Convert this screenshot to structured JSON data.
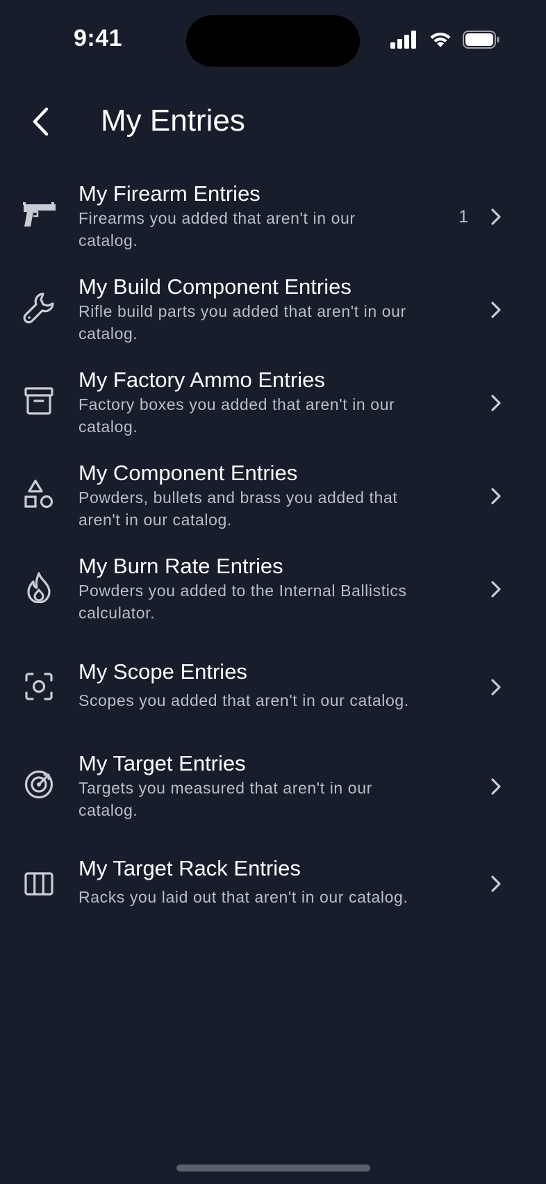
{
  "status_bar": {
    "time": "9:41"
  },
  "header": {
    "title": "My Entries"
  },
  "entries": [
    {
      "title": "My Firearm Entries",
      "subtitle": "Firearms you added that aren't in our catalog.",
      "count": "1",
      "icon": "pistol-icon"
    },
    {
      "title": "My Build Component Entries",
      "subtitle": "Rifle build parts you added that aren't in our catalog.",
      "count": "",
      "icon": "wrench-icon"
    },
    {
      "title": "My Factory Ammo Entries",
      "subtitle": "Factory boxes you added that aren't in our catalog.",
      "count": "",
      "icon": "archive-box-icon"
    },
    {
      "title": "My Component Entries",
      "subtitle": "Powders, bullets and brass you added that aren't in our catalog.",
      "count": "",
      "icon": "shapes-icon"
    },
    {
      "title": "My Burn Rate Entries",
      "subtitle": "Powders you added to the Internal Ballistics calculator.",
      "count": "",
      "icon": "flame-icon"
    },
    {
      "title": "My Scope Entries",
      "subtitle": "Scopes you added that aren't in our catalog.",
      "count": "",
      "icon": "scope-focus-icon"
    },
    {
      "title": "My Target Entries",
      "subtitle": "Targets you measured that aren't in our catalog.",
      "count": "",
      "icon": "target-icon"
    },
    {
      "title": "My Target Rack Entries",
      "subtitle": "Racks you laid out that aren't in our catalog.",
      "count": "",
      "icon": "rack-columns-icon"
    }
  ],
  "colors": {
    "background": "#181d2b",
    "title_text": "#ffffff",
    "subtitle_text": "#b9bdc8",
    "icon": "#c9ccd4"
  }
}
